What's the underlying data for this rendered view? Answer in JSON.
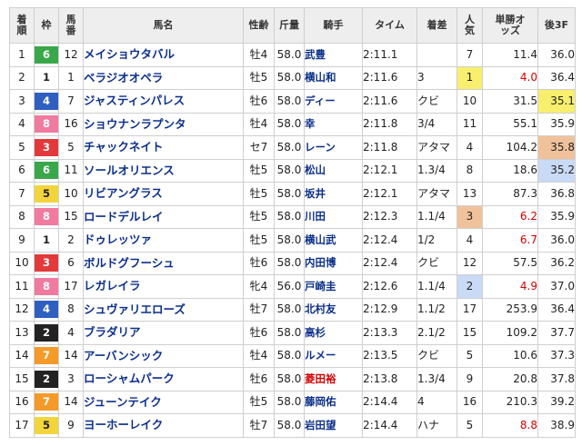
{
  "headers": {
    "rank": "着順",
    "waku": "枠",
    "umaban": "馬番",
    "horse": "馬名",
    "sexage": "性齢",
    "weight": "斤量",
    "jockey": "騎手",
    "time": "タイム",
    "margin": "着差",
    "pop": "人気",
    "odds": "単勝オッズ",
    "last3f": "後3F"
  },
  "colors": {
    "waku": {
      "1": {
        "bg": "#ffffff",
        "fg": "#222222"
      },
      "2": {
        "bg": "#222222",
        "fg": "#ffffff"
      },
      "3": {
        "bg": "#e23a3a",
        "fg": "#ffffff"
      },
      "4": {
        "bg": "#2f5fbf",
        "fg": "#ffffff"
      },
      "5": {
        "bg": "#f2d53c",
        "fg": "#222222"
      },
      "6": {
        "bg": "#3aa84a",
        "fg": "#ffffff"
      },
      "7": {
        "bg": "#f39a2a",
        "fg": "#ffffff"
      },
      "8": {
        "bg": "#f07aa0",
        "fg": "#ffffff"
      }
    },
    "highlight_1": "#f7ef6d",
    "highlight_2": "#c9daf6",
    "highlight_3": "#f0c29c",
    "odds_red": "#d40000",
    "link_blue": "#0b2f8a"
  },
  "rows": [
    {
      "rank": "1",
      "waku": "6",
      "umaban": "12",
      "horse": "メイショウタバル",
      "sexage": "牡4",
      "weight": "58.0",
      "jockey": "武豊",
      "time": "2:11.1",
      "margin": "",
      "pop": "7",
      "odds": "11.4",
      "last3f": "36.0"
    },
    {
      "rank": "2",
      "waku": "1",
      "umaban": "1",
      "horse": "ベラジオオペラ",
      "sexage": "牡5",
      "weight": "58.0",
      "jockey": "横山和",
      "time": "2:11.6",
      "margin": "3",
      "pop": "1",
      "odds": "4.0",
      "last3f": "36.4"
    },
    {
      "rank": "3",
      "waku": "4",
      "umaban": "7",
      "horse": "ジャスティンパレス",
      "sexage": "牡6",
      "weight": "58.0",
      "jockey": "ディー",
      "time": "2:11.6",
      "margin": "クビ",
      "pop": "10",
      "odds": "31.5",
      "last3f": "35.1"
    },
    {
      "rank": "4",
      "waku": "8",
      "umaban": "16",
      "horse": "ショウナンラプンタ",
      "sexage": "牡4",
      "weight": "58.0",
      "jockey": "幸",
      "time": "2:11.8",
      "margin": "3/4",
      "pop": "11",
      "odds": "55.1",
      "last3f": "35.9"
    },
    {
      "rank": "5",
      "waku": "3",
      "umaban": "5",
      "horse": "チャックネイト",
      "sexage": "セ7",
      "weight": "58.0",
      "jockey": "レーン",
      "time": "2:11.8",
      "margin": "アタマ",
      "pop": "4",
      "odds": "104.2",
      "last3f": "35.8"
    },
    {
      "rank": "6",
      "waku": "6",
      "umaban": "11",
      "horse": "ソールオリエンス",
      "sexage": "牡5",
      "weight": "58.0",
      "jockey": "松山",
      "time": "2:12.1",
      "margin": "1.3/4",
      "pop": "8",
      "odds": "18.6",
      "last3f": "35.2"
    },
    {
      "rank": "7",
      "waku": "5",
      "umaban": "10",
      "horse": "リビアングラス",
      "sexage": "牡5",
      "weight": "58.0",
      "jockey": "坂井",
      "time": "2:12.1",
      "margin": "アタマ",
      "pop": "13",
      "odds": "87.3",
      "last3f": "36.8"
    },
    {
      "rank": "8",
      "waku": "8",
      "umaban": "15",
      "horse": "ロードデルレイ",
      "sexage": "牡5",
      "weight": "58.0",
      "jockey": "川田",
      "time": "2:12.3",
      "margin": "1.1/4",
      "pop": "3",
      "odds": "6.2",
      "last3f": "35.9"
    },
    {
      "rank": "9",
      "waku": "1",
      "umaban": "2",
      "horse": "ドゥレッツァ",
      "sexage": "牡5",
      "weight": "58.0",
      "jockey": "横山武",
      "time": "2:12.4",
      "margin": "1/2",
      "pop": "4",
      "odds": "6.7",
      "last3f": "36.0"
    },
    {
      "rank": "10",
      "waku": "3",
      "umaban": "6",
      "horse": "ボルドグフーシュ",
      "sexage": "牡6",
      "weight": "58.0",
      "jockey": "内田博",
      "time": "2:12.4",
      "margin": "クビ",
      "pop": "12",
      "odds": "57.5",
      "last3f": "36.2"
    },
    {
      "rank": "11",
      "waku": "8",
      "umaban": "17",
      "horse": "レガレイラ",
      "sexage": "牝4",
      "weight": "56.0",
      "jockey": "戸崎圭",
      "time": "2:12.6",
      "margin": "1.1/4",
      "pop": "2",
      "odds": "4.9",
      "last3f": "37.0"
    },
    {
      "rank": "12",
      "waku": "4",
      "umaban": "8",
      "horse": "シュヴァリエローズ",
      "sexage": "牡7",
      "weight": "58.0",
      "jockey": "北村友",
      "time": "2:12.9",
      "margin": "1.1/2",
      "pop": "17",
      "odds": "253.9",
      "last3f": "36.4"
    },
    {
      "rank": "13",
      "waku": "2",
      "umaban": "4",
      "horse": "ブラダリア",
      "sexage": "牡6",
      "weight": "58.0",
      "jockey": "高杉",
      "time": "2:13.3",
      "margin": "2.1/2",
      "pop": "15",
      "odds": "109.2",
      "last3f": "37.7"
    },
    {
      "rank": "14",
      "waku": "7",
      "umaban": "14",
      "horse": "アーバンシック",
      "sexage": "牡4",
      "weight": "58.0",
      "jockey": "ルメー",
      "time": "2:13.5",
      "margin": "クビ",
      "pop": "5",
      "odds": "10.6",
      "last3f": "37.3"
    },
    {
      "rank": "15",
      "waku": "2",
      "umaban": "3",
      "horse": "ローシャムパーク",
      "sexage": "牡6",
      "weight": "58.0",
      "jockey": "菱田裕",
      "time": "2:13.8",
      "margin": "1.3/4",
      "pop": "9",
      "odds": "20.8",
      "last3f": "37.8"
    },
    {
      "rank": "16",
      "waku": "7",
      "umaban": "14",
      "horse": "ジューンテイク",
      "sexage": "牡5",
      "weight": "58.0",
      "jockey": "藤岡佑",
      "time": "2:14.4",
      "margin": "4",
      "pop": "16",
      "odds": "210.3",
      "last3f": "39.2"
    },
    {
      "rank": "17",
      "waku": "5",
      "umaban": "9",
      "horse": "ヨーホーレイク",
      "sexage": "牡7",
      "weight": "58.0",
      "jockey": "岩田望",
      "time": "2:14.4",
      "margin": "ハナ",
      "pop": "5",
      "odds": "8.8",
      "last3f": "38.9"
    }
  ]
}
